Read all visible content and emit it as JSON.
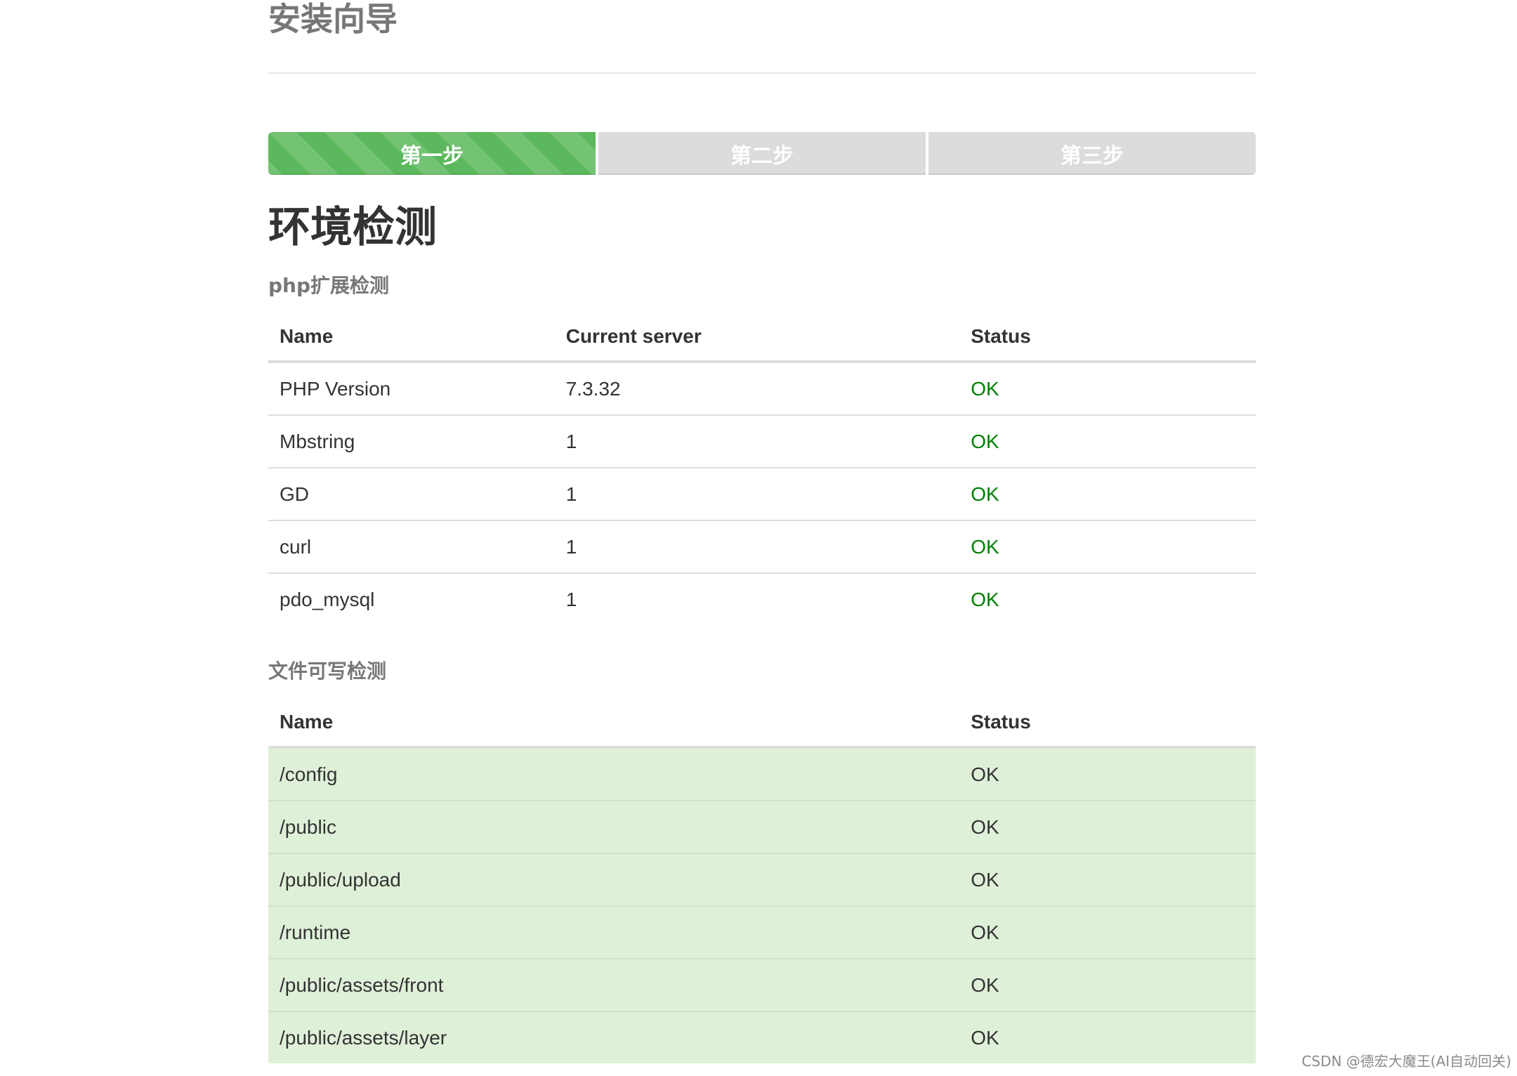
{
  "page": {
    "title": "安装向导"
  },
  "steps": [
    {
      "label": "第一步",
      "active": true
    },
    {
      "label": "第二步",
      "active": false
    },
    {
      "label": "第三步",
      "active": false
    }
  ],
  "section": {
    "title": "环境检测"
  },
  "php_extensions": {
    "heading": "php扩展检测",
    "columns": [
      "Name",
      "Current server",
      "Status"
    ],
    "rows": [
      {
        "name": "PHP Version",
        "current": "7.3.32",
        "status": "OK"
      },
      {
        "name": "Mbstring",
        "current": "1",
        "status": "OK"
      },
      {
        "name": "GD",
        "current": "1",
        "status": "OK"
      },
      {
        "name": "curl",
        "current": "1",
        "status": "OK"
      },
      {
        "name": "pdo_mysql",
        "current": "1",
        "status": "OK"
      }
    ]
  },
  "file_writable": {
    "heading": "文件可写检测",
    "columns": [
      "Name",
      "Status"
    ],
    "rows": [
      {
        "name": "/config",
        "status": "OK"
      },
      {
        "name": "/public",
        "status": "OK"
      },
      {
        "name": "/public/upload",
        "status": "OK"
      },
      {
        "name": "/runtime",
        "status": "OK"
      },
      {
        "name": "/public/assets/front",
        "status": "OK"
      },
      {
        "name": "/public/assets/layer",
        "status": "OK"
      }
    ]
  },
  "watermark": "CSDN @德宏大魔王(AI自动回关)",
  "colors": {
    "ok_green": "#008000",
    "progress_green": "#5cb85c",
    "step_inactive": "#dcdcdc",
    "row_success": "#dff0d8"
  }
}
